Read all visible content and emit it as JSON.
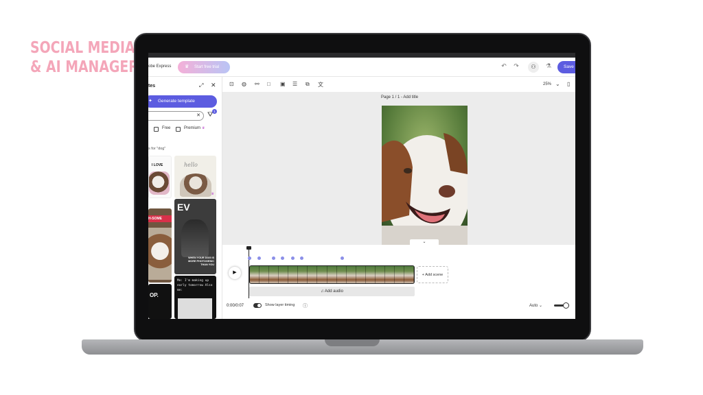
{
  "brand": {
    "line1": "SOCIAL MEDIA",
    "line2": "& AI MANAGER"
  },
  "topbar": {
    "app_name": "obe Express",
    "trial_label": "Start free trial",
    "save_label": "Save"
  },
  "panel": {
    "title": "tes",
    "generate_label": "Generate template",
    "filter_count": "1",
    "free_label": "Free",
    "premium_label": "Premium",
    "results_label": "s for \"dog\""
  },
  "tiles": [
    {
      "caption": "I LOVE"
    },
    {
      "caption": "hello"
    },
    {
      "caption": "H-SOME"
    },
    {
      "caption": "WHEN YOUR DOG IS MORE PHOTOGENIC THAN YOU"
    },
    {
      "caption": "OP."
    },
    {
      "caption": "Me: I'm making up early tomorrow Also me:"
    }
  ],
  "canvas": {
    "zoom_label": "25%",
    "page_label": "Page 1 / 1 - Add title"
  },
  "timeline": {
    "add_scene_label": "+ Add scene",
    "add_audio_label": "Add audio",
    "time_label": "0:00/0:07",
    "show_layer_timing_label": "Show layer timing",
    "auto_label": "Auto"
  },
  "colors": {
    "accent": "#5c5ce0",
    "brand_pink": "#f4a6b9"
  }
}
